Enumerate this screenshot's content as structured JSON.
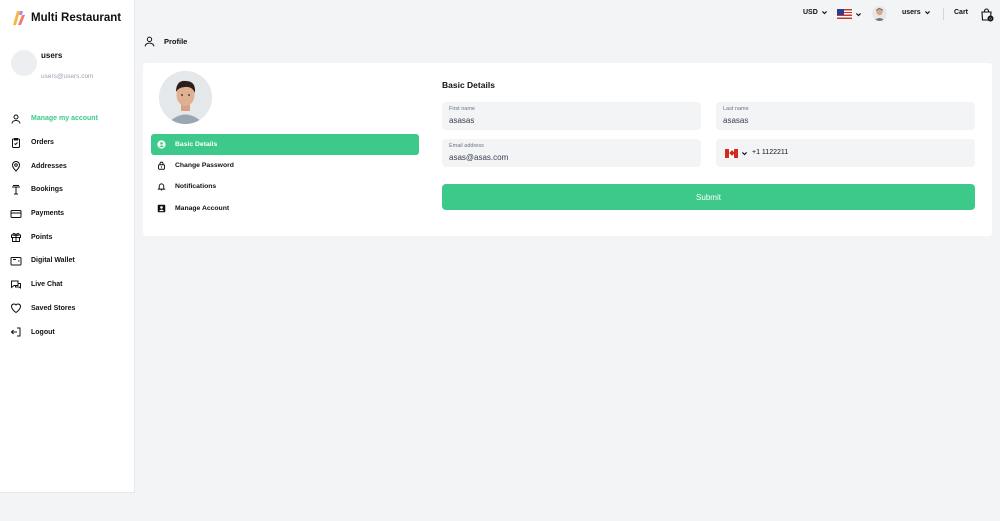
{
  "app": {
    "title": "Multi Restaurant"
  },
  "user": {
    "name": "users",
    "email": "users@users.com"
  },
  "sidebar": {
    "items": [
      {
        "label": "Manage my account",
        "icon": "user-icon",
        "active": true
      },
      {
        "label": "Orders",
        "icon": "clipboard-check-icon"
      },
      {
        "label": "Addresses",
        "icon": "map-pin-icon"
      },
      {
        "label": "Bookings",
        "icon": "table-icon"
      },
      {
        "label": "Payments",
        "icon": "credit-card-icon"
      },
      {
        "label": "Points",
        "icon": "gift-icon"
      },
      {
        "label": "Digital Wallet",
        "icon": "wallet-icon"
      },
      {
        "label": "Live Chat",
        "icon": "chat-icon"
      },
      {
        "label": "Saved Stores",
        "icon": "heart-icon"
      },
      {
        "label": "Logout",
        "icon": "logout-icon"
      }
    ]
  },
  "topbar": {
    "currency": "USD",
    "language_flag": "us-flag-icon",
    "user_label": "users",
    "cart_label": "Cart",
    "cart_count": "0"
  },
  "breadcrumb": {
    "title": "Profile"
  },
  "profile_menu": {
    "items": [
      {
        "label": "Basic Details",
        "icon": "user-circle-icon",
        "active": true
      },
      {
        "label": "Change Password",
        "icon": "lock-icon"
      },
      {
        "label": "Notifications",
        "icon": "bell-icon"
      },
      {
        "label": "Manage Account",
        "icon": "account-box-icon"
      }
    ]
  },
  "form": {
    "title": "Basic Details",
    "first_name": {
      "label": "First name",
      "value": "asasas"
    },
    "last_name": {
      "label": "Last name",
      "value": "asasas"
    },
    "email": {
      "label": "Email address",
      "value": "asas@asas.com"
    },
    "phone": {
      "value": "+1 1122211",
      "country_flag": "canada-flag-icon"
    },
    "submit_label": "Submit"
  },
  "colors": {
    "accent": "#3cc98a",
    "background": "#f3f4f6"
  }
}
